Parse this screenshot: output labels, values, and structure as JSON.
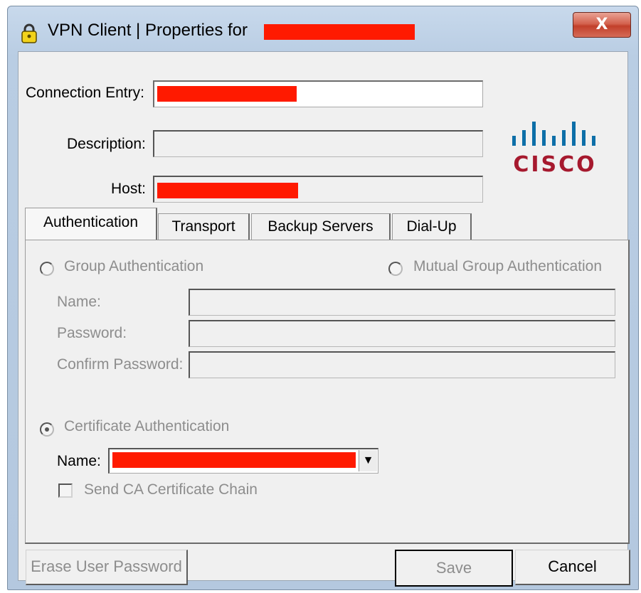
{
  "window": {
    "title": "VPN Client  |  Properties for",
    "close_label": "X"
  },
  "form": {
    "connection_entry_label": "Connection Entry:",
    "description_label": "Description:",
    "host_label": "Host:"
  },
  "logo": {
    "text": "CISCO",
    "color": "#a6192e",
    "bars_color": "#0d6fa8"
  },
  "tabs": [
    {
      "label": "Authentication",
      "active": true
    },
    {
      "label": "Transport"
    },
    {
      "label": "Backup Servers"
    },
    {
      "label": "Dial-Up"
    }
  ],
  "auth": {
    "group_auth_label": "Group Authentication",
    "mutual_group_auth_label": "Mutual Group Authentication",
    "name_label": "Name:",
    "password_label": "Password:",
    "confirm_password_label": "Confirm Password:",
    "certificate_auth_label": "Certificate Authentication",
    "cert_name_label": "Name:",
    "send_ca_chain_label": "Send CA Certificate Chain"
  },
  "buttons": {
    "erase_password": "Erase User Password",
    "save": "Save",
    "cancel": "Cancel"
  },
  "colors": {
    "redaction": "#ff1a00"
  }
}
